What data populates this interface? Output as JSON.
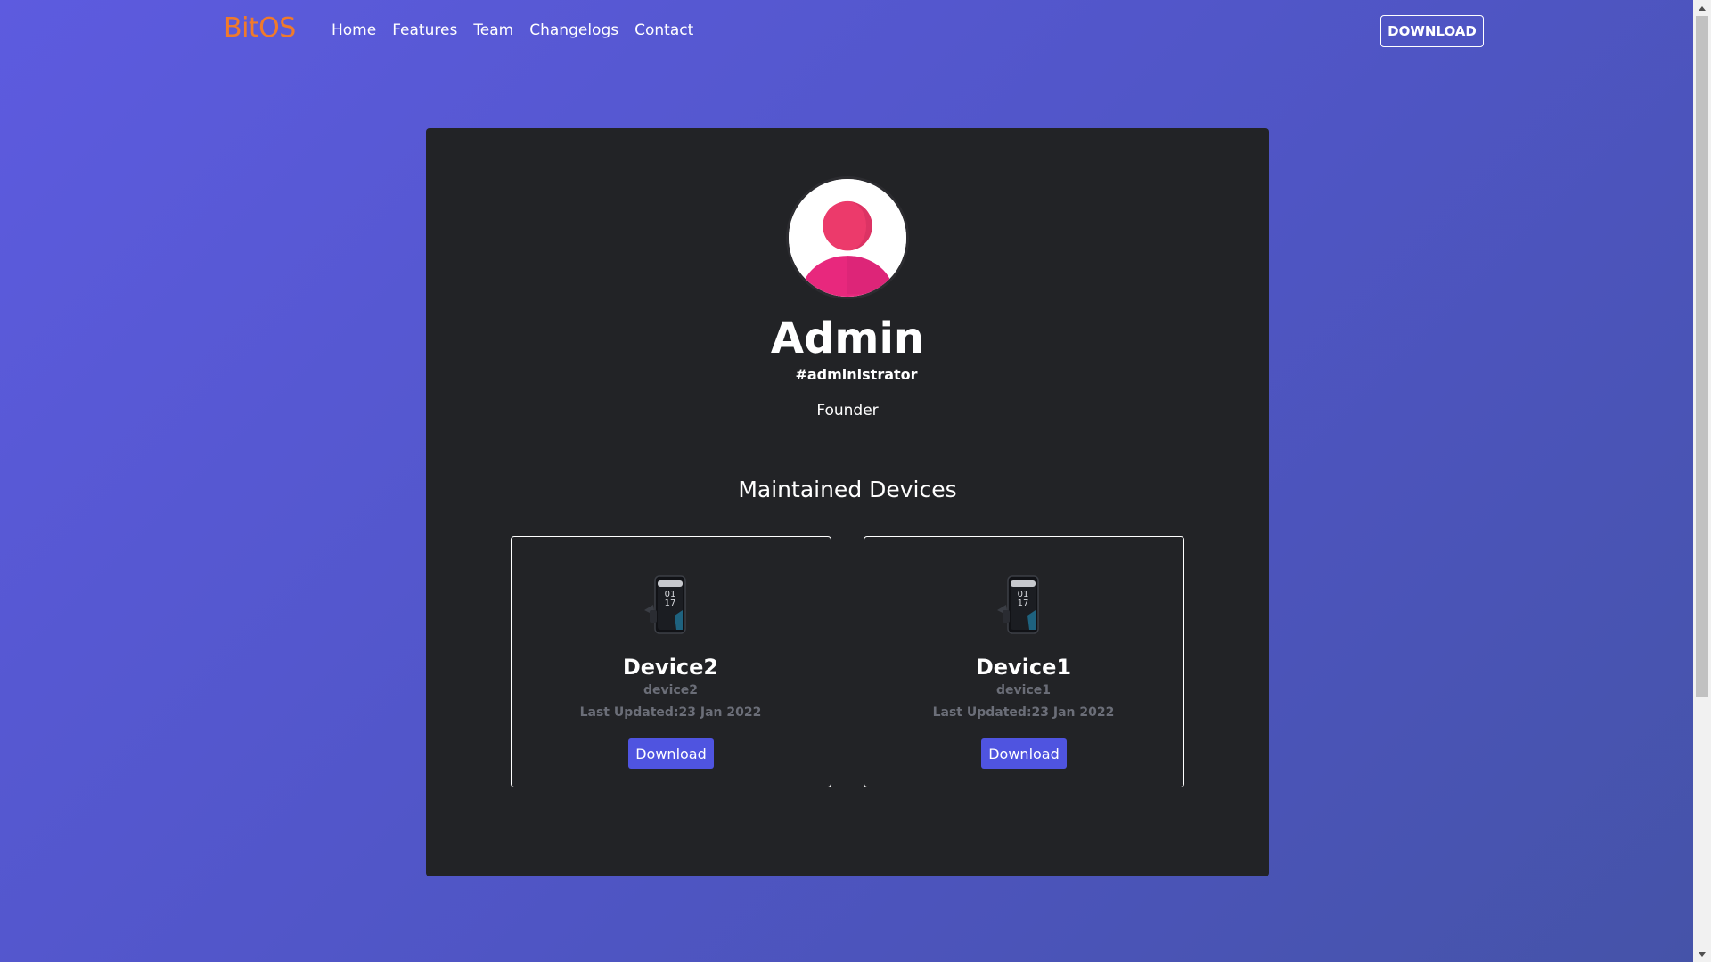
{
  "navbar": {
    "brand": "BitOS",
    "links": [
      {
        "label": "Home"
      },
      {
        "label": "Features"
      },
      {
        "label": "Team"
      },
      {
        "label": "Changelogs"
      },
      {
        "label": "Contact"
      }
    ],
    "download_label": "DOWNLOAD"
  },
  "profile": {
    "name": "Admin",
    "handle": "#administrator",
    "role": "Founder",
    "avatar_icon": "user-avatar-icon"
  },
  "devices_section": {
    "title": "Maintained Devices",
    "devices": [
      {
        "name": "Device2",
        "code": "device2",
        "updated": "Last Updated:23 Jan 2022",
        "download_label": "Download",
        "icon": "phone-icon"
      },
      {
        "name": "Device1",
        "code": "device1",
        "updated": "Last Updated:23 Jan 2022",
        "download_label": "Download",
        "icon": "phone-icon"
      }
    ]
  },
  "colors": {
    "brand": "#f07a2b",
    "card_bg": "#222326",
    "accent_button": "#4f54e0",
    "avatar_head": "#ec3a6b",
    "avatar_body": "#e8287d"
  }
}
